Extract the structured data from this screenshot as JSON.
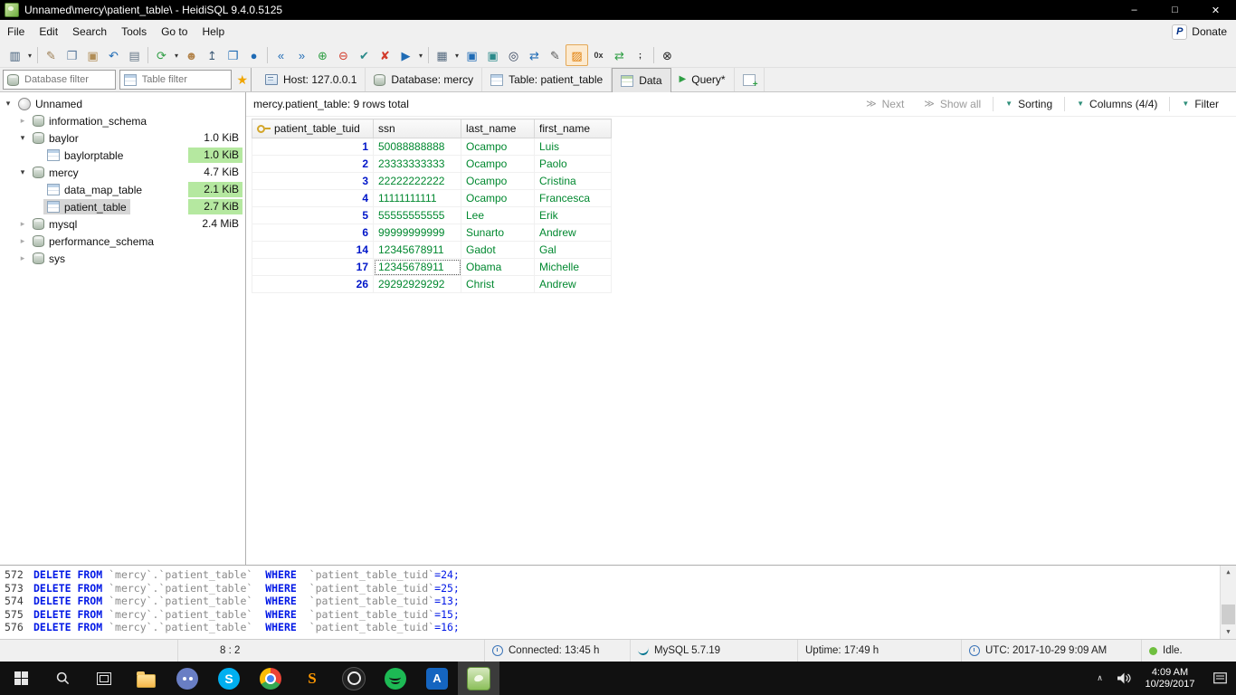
{
  "colors": {
    "titlebar_bg": "#000000",
    "chrome_bg": "#f0f0f0",
    "size_badge_green": "#b5e8a0",
    "selected_row_gray": "#d6d6d6",
    "int_value_blue": "#0016c9",
    "string_value_green": "#00882f",
    "sql_keyword_blue": "#0017e6",
    "sql_identifier_gray": "#8a8a8a",
    "taskbar_bg": "#111111"
  },
  "titlebar": {
    "title": "Unnamed\\mercy\\patient_table\\ - HeidiSQL 9.4.0.5125",
    "buttons": [
      {
        "name": "minimize-button",
        "glyph": "–"
      },
      {
        "name": "maximize-button",
        "glyph": "□"
      },
      {
        "name": "close-button",
        "glyph": "✕"
      }
    ]
  },
  "menubar": {
    "items": [
      "File",
      "Edit",
      "Search",
      "Tools",
      "Go to",
      "Help"
    ],
    "donate_label": "Donate",
    "donate_icon_glyph": "P"
  },
  "toolbar": {
    "items": [
      {
        "name": "session-manager-icon",
        "glyph": "▥",
        "color": "#3f5c78"
      },
      {
        "name": "session-dropdown-icon",
        "glyph": "▾",
        "color": "#333333",
        "drop": true
      },
      {
        "sep": true
      },
      {
        "name": "open-sql-file-icon",
        "glyph": "✎",
        "color": "#9a7b4f"
      },
      {
        "name": "copy-icon",
        "glyph": "❐",
        "color": "#5b7a9d"
      },
      {
        "name": "paste-icon",
        "glyph": "▣",
        "color": "#b08d57"
      },
      {
        "name": "undo-icon",
        "glyph": "↶",
        "color": "#1f6bb5"
      },
      {
        "name": "print-icon",
        "glyph": "▤",
        "color": "#667788"
      },
      {
        "sep": true
      },
      {
        "name": "refresh-icon",
        "glyph": "⟳",
        "color": "#2f9e44"
      },
      {
        "name": "refresh-dropdown-icon",
        "glyph": "▾",
        "color": "#333333",
        "drop": true
      },
      {
        "name": "user-manager-icon",
        "glyph": "☻",
        "color": "#b3854d"
      },
      {
        "name": "export-database-icon",
        "glyph": "↥",
        "color": "#3f5c78"
      },
      {
        "name": "copy-data-icon",
        "glyph": "❐",
        "color": "#1f6bb5"
      },
      {
        "name": "connection-info-icon",
        "glyph": "●",
        "color": "#1f6bb5"
      },
      {
        "sep": true
      },
      {
        "name": "first-row-icon",
        "glyph": "«",
        "color": "#1f6bb5"
      },
      {
        "name": "last-row-icon",
        "glyph": "»",
        "color": "#1f6bb5"
      },
      {
        "name": "insert-row-icon",
        "glyph": "⊕",
        "color": "#2f9e44"
      },
      {
        "name": "delete-row-icon",
        "glyph": "⊖",
        "color": "#d23a2a"
      },
      {
        "name": "post-changes-icon",
        "glyph": "✔",
        "color": "#2b8a8a"
      },
      {
        "name": "discard-changes-icon",
        "glyph": "✘",
        "color": "#d23a2a"
      },
      {
        "name": "execute-sql-icon",
        "glyph": "▶",
        "color": "#1f6bb5"
      },
      {
        "name": "execute-dropdown-icon",
        "glyph": "▾",
        "color": "#333333",
        "drop": true
      },
      {
        "sep": true
      },
      {
        "name": "grid-view-icon",
        "glyph": "▦",
        "color": "#556a7f"
      },
      {
        "name": "grid-view-dropdown-icon",
        "glyph": "▾",
        "color": "#333333",
        "drop": true
      },
      {
        "name": "save-icon",
        "glyph": "▣",
        "color": "#1f6bb5"
      },
      {
        "name": "save-as-icon",
        "glyph": "▣",
        "color": "#2b8a8a"
      },
      {
        "name": "find-icon",
        "glyph": "◎",
        "color": "#33425b"
      },
      {
        "name": "replace-icon",
        "glyph": "⇄",
        "color": "#1f6bb5"
      },
      {
        "name": "edit-inline-icon",
        "glyph": "✎",
        "color": "#555555"
      },
      {
        "name": "highlight-syntax-icon",
        "glyph": "▨",
        "color": "#e07b00",
        "pressed": true
      },
      {
        "name": "hex-view-icon",
        "glyph": "0x",
        "color": "#333333",
        "text": true
      },
      {
        "name": "reformat-sql-icon",
        "glyph": "⇄",
        "color": "#2f9e44"
      },
      {
        "name": "delimiter-icon",
        "glyph": ";",
        "color": "#111111",
        "text": true
      },
      {
        "sep": true
      },
      {
        "name": "cancel-operation-icon",
        "glyph": "⊗",
        "color": "#222222"
      }
    ]
  },
  "filters": {
    "database_filter_placeholder": "Database filter",
    "table_filter_placeholder": "Table filter"
  },
  "tabs": [
    {
      "id": "host",
      "icon": "host-icon",
      "label": "Host: 127.0.0.1",
      "active": false
    },
    {
      "id": "database",
      "icon": "database-icon",
      "label": "Database: mercy",
      "active": false
    },
    {
      "id": "table",
      "icon": "table-icon",
      "label": "Table: patient_table",
      "active": false
    },
    {
      "id": "data",
      "icon": "data-icon",
      "label": "Data",
      "active": true
    },
    {
      "id": "query",
      "icon": "query-icon",
      "label": "Query*",
      "active": false
    }
  ],
  "tree": {
    "items": [
      {
        "label": "Unnamed",
        "level": 0,
        "expand": "open",
        "icon": "session-icon",
        "size": "",
        "size_green": false,
        "selected": false
      },
      {
        "label": "information_schema",
        "level": 1,
        "expand": "closed",
        "icon": "database-icon",
        "size": "",
        "size_green": false,
        "selected": false
      },
      {
        "label": "baylor",
        "level": 1,
        "expand": "open",
        "icon": "database-icon",
        "size": "1.0 KiB",
        "size_green": false,
        "selected": false
      },
      {
        "label": "baylorptable",
        "level": 2,
        "expand": "none",
        "icon": "table-icon",
        "size": "1.0 KiB",
        "size_green": true,
        "selected": false
      },
      {
        "label": "mercy",
        "level": 1,
        "expand": "open",
        "icon": "database-icon",
        "size": "4.7 KiB",
        "size_green": false,
        "selected": false
      },
      {
        "label": "data_map_table",
        "level": 2,
        "expand": "none",
        "icon": "table-icon",
        "size": "2.1 KiB",
        "size_green": true,
        "selected": false
      },
      {
        "label": "patient_table",
        "level": 2,
        "expand": "none",
        "icon": "table-icon",
        "size": "2.7 KiB",
        "size_green": true,
        "selected": true
      },
      {
        "label": "mysql",
        "level": 1,
        "expand": "closed",
        "icon": "database-icon",
        "size": "2.4 MiB",
        "size_green": false,
        "selected": false
      },
      {
        "label": "performance_schema",
        "level": 1,
        "expand": "closed",
        "icon": "database-icon",
        "size": "",
        "size_green": false,
        "selected": false
      },
      {
        "label": "sys",
        "level": 1,
        "expand": "closed",
        "icon": "database-icon",
        "size": "",
        "size_green": false,
        "selected": false
      }
    ]
  },
  "data_panel": {
    "summary": "mercy.patient_table: 9 rows total",
    "controls": [
      {
        "id": "next",
        "label": "Next",
        "icon": "next-icon",
        "disabled": true,
        "sep_before": false
      },
      {
        "id": "show-all",
        "label": "Show all",
        "icon": "show-all-icon",
        "disabled": true,
        "sep_before": false
      },
      {
        "id": "sorting",
        "label": "Sorting",
        "icon": "dropdown-icon",
        "disabled": false,
        "sep_before": true
      },
      {
        "id": "columns",
        "label": "Columns (4/4)",
        "icon": "dropdown-icon",
        "disabled": false,
        "sep_before": true
      },
      {
        "id": "filter",
        "label": "Filter",
        "icon": "dropdown-icon",
        "disabled": false,
        "sep_before": true
      }
    ],
    "grid": {
      "columns": [
        {
          "name": "patient_table_tuid",
          "type": "int",
          "key": true
        },
        {
          "name": "ssn",
          "type": "str",
          "key": false
        },
        {
          "name": "last_name",
          "type": "str",
          "key": false
        },
        {
          "name": "first_name",
          "type": "str",
          "key": false
        }
      ],
      "rows": [
        {
          "cells": [
            "1",
            "50088888888",
            "Ocampo",
            "Luis"
          ],
          "focused_cell": -1
        },
        {
          "cells": [
            "2",
            "23333333333",
            "Ocampo",
            "Paolo"
          ],
          "focused_cell": -1
        },
        {
          "cells": [
            "3",
            "22222222222",
            "Ocampo",
            "Cristina"
          ],
          "focused_cell": -1
        },
        {
          "cells": [
            "4",
            "11111111111",
            "Ocampo",
            "Francesca"
          ],
          "focused_cell": -1
        },
        {
          "cells": [
            "5",
            "55555555555",
            "Lee",
            "Erik"
          ],
          "focused_cell": -1
        },
        {
          "cells": [
            "6",
            "99999999999",
            "Sunarto",
            "Andrew"
          ],
          "focused_cell": -1
        },
        {
          "cells": [
            "14",
            "12345678911",
            "Gadot",
            "Gal"
          ],
          "focused_cell": -1
        },
        {
          "cells": [
            "17",
            "12345678911",
            "Obama",
            "Michelle"
          ],
          "focused_cell": 1
        },
        {
          "cells": [
            "26",
            "29292929292",
            "Christ",
            "Andrew"
          ],
          "focused_cell": -1
        }
      ]
    }
  },
  "sql_log": {
    "lines": [
      {
        "num": "572",
        "segments": [
          [
            "DELETE FROM ",
            "kw"
          ],
          [
            "`mercy`.`patient_table`  ",
            "id"
          ],
          [
            "WHERE  ",
            "kw"
          ],
          [
            "`patient_table_tuid`",
            "id"
          ],
          [
            "=24;",
            "val"
          ]
        ]
      },
      {
        "num": "573",
        "segments": [
          [
            "DELETE FROM ",
            "kw"
          ],
          [
            "`mercy`.`patient_table`  ",
            "id"
          ],
          [
            "WHERE  ",
            "kw"
          ],
          [
            "`patient_table_tuid`",
            "id"
          ],
          [
            "=25;",
            "val"
          ]
        ]
      },
      {
        "num": "574",
        "segments": [
          [
            "DELETE FROM ",
            "kw"
          ],
          [
            "`mercy`.`patient_table`  ",
            "id"
          ],
          [
            "WHERE  ",
            "kw"
          ],
          [
            "`patient_table_tuid`",
            "id"
          ],
          [
            "=13;",
            "val"
          ]
        ]
      },
      {
        "num": "575",
        "segments": [
          [
            "DELETE FROM ",
            "kw"
          ],
          [
            "`mercy`.`patient_table`  ",
            "id"
          ],
          [
            "WHERE  ",
            "kw"
          ],
          [
            "`patient_table_tuid`",
            "id"
          ],
          [
            "=15;",
            "val"
          ]
        ]
      },
      {
        "num": "576",
        "segments": [
          [
            "DELETE FROM ",
            "kw"
          ],
          [
            "`mercy`.`patient_table`  ",
            "id"
          ],
          [
            "WHERE  ",
            "kw"
          ],
          [
            "`patient_table_tuid`",
            "id"
          ],
          [
            "=16;",
            "val"
          ]
        ]
      }
    ]
  },
  "statusbar": {
    "segments": [
      {
        "text": "",
        "icon": ""
      },
      {
        "text": "8 : 2",
        "icon": ""
      },
      {
        "text": "Connected: 13:45 h",
        "icon": "clock-icon"
      },
      {
        "text": "MySQL 5.7.19",
        "icon": "mysql-icon"
      },
      {
        "text": "Uptime: 17:49 h",
        "icon": ""
      },
      {
        "text": "UTC: 2017-10-29 9:09 AM",
        "icon": "clock-icon"
      },
      {
        "text": "Idle.",
        "icon": "idle-icon"
      }
    ]
  },
  "taskbar": {
    "system": [
      {
        "name": "start-button"
      },
      {
        "name": "search-button"
      },
      {
        "name": "task-view-button"
      }
    ],
    "apps": [
      {
        "name": "file-explorer-icon",
        "active": false
      },
      {
        "name": "discord-icon",
        "active": false
      },
      {
        "name": "skype-icon",
        "active": false
      },
      {
        "name": "chrome-icon",
        "active": false
      },
      {
        "name": "sublime-text-icon",
        "active": false
      },
      {
        "name": "media-player-icon",
        "active": false
      },
      {
        "name": "spotify-icon",
        "active": false
      },
      {
        "name": "reader-app-icon",
        "active": false
      },
      {
        "name": "heidisql-icon",
        "active": true
      }
    ],
    "tray": [
      {
        "name": "tray-expand-icon"
      },
      {
        "name": "volume-icon"
      }
    ],
    "clock": {
      "time": "4:09 AM",
      "date": "10/29/2017"
    },
    "action_center": {
      "name": "action-center-icon"
    }
  }
}
